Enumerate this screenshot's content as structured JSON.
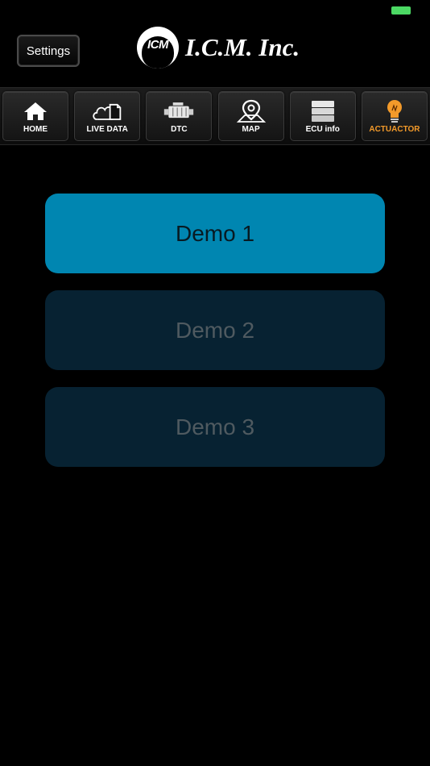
{
  "header": {
    "settings_label": "Settings",
    "logo_badge": "ICM",
    "logo_text": "I.C.M. Inc."
  },
  "toolbar": {
    "items": [
      {
        "label": "HOME",
        "icon": "home-icon",
        "active": false
      },
      {
        "label": "LIVE DATA",
        "icon": "cloud-document-icon",
        "active": false
      },
      {
        "label": "DTC",
        "icon": "engine-icon",
        "active": false
      },
      {
        "label": "MAP",
        "icon": "map-pin-icon",
        "active": false
      },
      {
        "label": "ECU info",
        "icon": "ecu-module-icon",
        "active": false
      },
      {
        "label": "ACTUACTOR",
        "icon": "lightbulb-icon",
        "active": true
      }
    ],
    "active_color": "#f39a2a"
  },
  "demos": [
    {
      "label": "Demo 1",
      "selected": true
    },
    {
      "label": "Demo 2",
      "selected": false
    },
    {
      "label": "Demo 3",
      "selected": false
    }
  ],
  "colors": {
    "accent": "#0086b1",
    "inactive_button": "#072232",
    "battery": "#4cd964"
  }
}
